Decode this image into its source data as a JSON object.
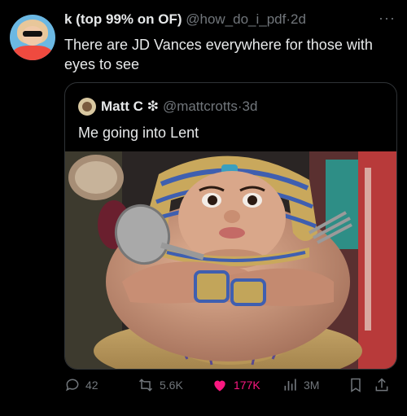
{
  "post": {
    "author_name": "k (top 99% on OF)",
    "author_handle": "@how_do_i_pdf",
    "time": "2d",
    "text": "There are JD Vances everywhere for those with eyes to see",
    "more_icon": "more-icon"
  },
  "quote": {
    "author_name": "Matt C",
    "badge": "❇",
    "author_handle": "@mattcrotts",
    "time": "3d",
    "text": "Me going into Lent"
  },
  "actions": {
    "replies": "42",
    "reposts": "5.6K",
    "likes": "177K",
    "views": "3M"
  },
  "colors": {
    "background": "#000000",
    "text": "#e7e9ea",
    "muted": "#71767b",
    "like": "#f91880",
    "border": "#2f3336"
  }
}
